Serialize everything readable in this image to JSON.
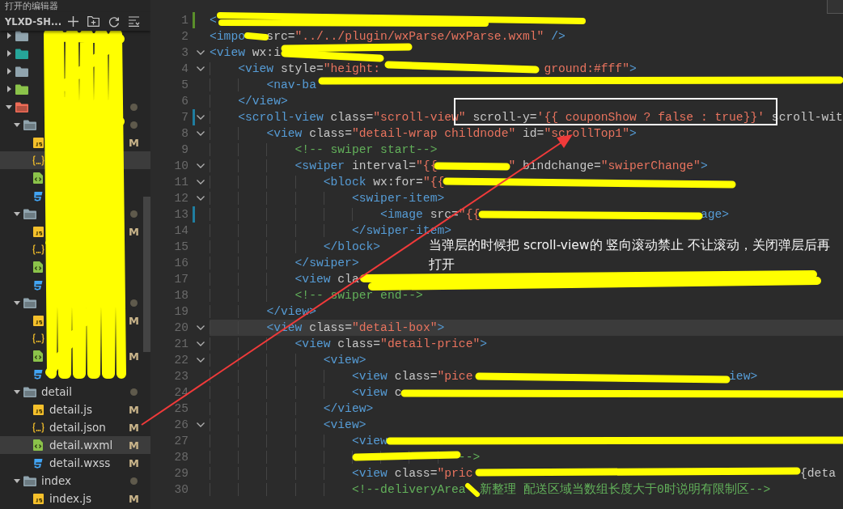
{
  "explorer": {
    "section_title": "打开的编辑器",
    "project": "YLXD-SH...",
    "tree": [
      {
        "kind": "folder",
        "color": "#90a4ae",
        "expanded": false,
        "selected": false
      },
      {
        "kind": "folder",
        "color": "#26a69a",
        "expanded": false,
        "selected": false
      },
      {
        "kind": "folder",
        "color": "#90a4ae",
        "expanded": false,
        "selected": false
      },
      {
        "kind": "folder",
        "color": "#8bc34a",
        "expanded": false,
        "selected": false
      },
      {
        "kind": "folder",
        "color": "#ef6c57",
        "expanded": true,
        "dot": true,
        "selected": false,
        "children": [
          {
            "kind": "folder",
            "color": "#90a4ae",
            "expanded": true,
            "dot": true,
            "selected": false,
            "children": [
              {
                "kind": "js",
                "badge": "M",
                "selected": false
              },
              {
                "kind": "json",
                "selected": true
              },
              {
                "kind": "wxml",
                "selected": false
              },
              {
                "kind": "wxss",
                "selected": false
              }
            ]
          },
          {
            "kind": "folder",
            "color": "#90a4ae",
            "expanded": true,
            "dot": true,
            "selected": false,
            "children": [
              {
                "kind": "js",
                "badge": "M",
                "selected": false
              },
              {
                "kind": "json",
                "selected": false
              },
              {
                "kind": "wxml",
                "selected": false
              },
              {
                "kind": "wxss",
                "selected": false
              }
            ]
          },
          {
            "kind": "folder",
            "color": "#90a4ae",
            "expanded": true,
            "dot": true,
            "selected": false,
            "children": [
              {
                "kind": "js",
                "badge": "M",
                "selected": false
              },
              {
                "kind": "json",
                "selected": false
              },
              {
                "kind": "wxml",
                "badge": "M",
                "selected": false
              },
              {
                "kind": "wxss",
                "selected": false
              }
            ]
          },
          {
            "kind": "folder",
            "name": "detail",
            "color": "#90a4ae",
            "expanded": true,
            "dot": true,
            "selected": false,
            "children": [
              {
                "kind": "js",
                "name": "detail.js",
                "badge": "M",
                "selected": false
              },
              {
                "kind": "json",
                "name": "detail.json",
                "badge": "M",
                "selected": false
              },
              {
                "kind": "wxml",
                "name": "detail.wxml",
                "badge": "M",
                "selected": true
              },
              {
                "kind": "wxss",
                "name": "detail.wxss",
                "badge": "M",
                "selected": false
              }
            ]
          },
          {
            "kind": "folder",
            "name": "index",
            "color": "#90a4ae",
            "expanded": true,
            "dot": true,
            "selected": false,
            "children": [
              {
                "kind": "js",
                "name": "index.js",
                "badge": "M",
                "selected": false
              }
            ]
          }
        ]
      }
    ]
  },
  "editor": {
    "lines": [
      {
        "number": "1",
        "added": true,
        "tokens": [
          {
            "kind": "tag",
            "text": "<"
          }
        ]
      },
      {
        "number": "2",
        "tokens": [
          {
            "kind": "tag",
            "text": "<impo"
          },
          {
            "kind": "attr",
            "text": "   src="
          },
          {
            "kind": "str",
            "text": "\"../../plugin/wxParse/wxParse.wxml\""
          },
          {
            "kind": "tag",
            "text": " />"
          }
        ]
      },
      {
        "number": "3",
        "fold": true,
        "tokens": [
          {
            "kind": "tag",
            "text": "<view"
          },
          {
            "kind": "attr",
            "text": " wx:i"
          }
        ]
      },
      {
        "number": "4",
        "fold": true,
        "tokens": [
          {
            "kind": "tag",
            "text": "    <view"
          },
          {
            "kind": "attr",
            "text": " style="
          },
          {
            "kind": "str",
            "text": "\"height:"
          },
          {
            "kind": "str",
            "text": "                       ground:#fff\""
          },
          {
            "kind": "tag",
            "text": ">"
          }
        ]
      },
      {
        "number": "5",
        "tokens": [
          {
            "kind": "tag",
            "text": "        <nav-ba"
          }
        ]
      },
      {
        "number": "6",
        "tokens": [
          {
            "kind": "tag",
            "text": "    </view>"
          }
        ]
      },
      {
        "number": "7",
        "modified": true,
        "fold": true,
        "tokens": [
          {
            "kind": "tag",
            "text": "    <scroll-view"
          },
          {
            "kind": "attr",
            "text": " class="
          },
          {
            "kind": "str",
            "text": "\"scroll-view\""
          },
          {
            "kind": "attr",
            "text": " scroll-y="
          },
          {
            "kind": "str",
            "text": "'{{ couponShow ? false : true}}'"
          },
          {
            "kind": "attr",
            "text": " scroll-wit"
          }
        ]
      },
      {
        "number": "8",
        "fold": true,
        "tokens": [
          {
            "kind": "tag",
            "text": "        <view"
          },
          {
            "kind": "attr",
            "text": " class="
          },
          {
            "kind": "str",
            "text": "\"detail-wrap childnode\""
          },
          {
            "kind": "attr",
            "text": " id="
          },
          {
            "kind": "str",
            "text": "\"scrollTop1\""
          },
          {
            "kind": "tag",
            "text": ">"
          }
        ]
      },
      {
        "number": "9",
        "tokens": [
          {
            "kind": "comment",
            "text": "            <!-- swiper start-->"
          }
        ]
      },
      {
        "number": "10",
        "fold": true,
        "tokens": [
          {
            "kind": "tag",
            "text": "            <swiper"
          },
          {
            "kind": "attr",
            "text": " interval="
          },
          {
            "kind": "str",
            "text": "\"{{"
          },
          {
            "kind": "str",
            "text": "          \""
          },
          {
            "kind": "attr",
            "text": " bindchange="
          },
          {
            "kind": "str",
            "text": "\"swiperChange\""
          },
          {
            "kind": "tag",
            "text": ">"
          }
        ]
      },
      {
        "number": "11",
        "fold": true,
        "tokens": [
          {
            "kind": "tag",
            "text": "                <block"
          },
          {
            "kind": "attr",
            "text": " wx:for="
          },
          {
            "kind": "str",
            "text": "\"{{"
          }
        ]
      },
      {
        "number": "12",
        "fold": true,
        "tokens": [
          {
            "kind": "tag",
            "text": "                    <swiper-item>"
          }
        ]
      },
      {
        "number": "13",
        "modified": true,
        "tokens": [
          {
            "kind": "tag",
            "text": "                        <image"
          },
          {
            "kind": "attr",
            "text": " src="
          },
          {
            "kind": "str",
            "text": "\"{{"
          },
          {
            "kind": "tag",
            "text": "                               age>"
          }
        ]
      },
      {
        "number": "14",
        "tokens": [
          {
            "kind": "tag",
            "text": "                    </swiper-item>"
          }
        ]
      },
      {
        "number": "15",
        "tokens": [
          {
            "kind": "tag",
            "text": "                </block>"
          }
        ]
      },
      {
        "number": "16",
        "tokens": [
          {
            "kind": "tag",
            "text": "            </swiper>"
          }
        ]
      },
      {
        "number": "17",
        "tokens": [
          {
            "kind": "tag",
            "text": "            <view"
          },
          {
            "kind": "attr",
            "text": " cla"
          }
        ]
      },
      {
        "number": "18",
        "tokens": [
          {
            "kind": "comment",
            "text": "            <!-- swiper end-->"
          }
        ]
      },
      {
        "number": "19",
        "tokens": [
          {
            "kind": "tag",
            "text": "        </view>"
          }
        ]
      },
      {
        "number": "20",
        "fold": true,
        "current": true,
        "tokens": [
          {
            "kind": "tag",
            "text": "        <view"
          },
          {
            "kind": "attr",
            "text": " class="
          },
          {
            "kind": "str",
            "text": "\"detail-box\""
          },
          {
            "kind": "tag",
            "text": ">"
          }
        ]
      },
      {
        "number": "21",
        "fold": true,
        "tokens": [
          {
            "kind": "tag",
            "text": "            <view"
          },
          {
            "kind": "attr",
            "text": " class="
          },
          {
            "kind": "str",
            "text": "\"detail-price\""
          },
          {
            "kind": "tag",
            "text": ">"
          }
        ]
      },
      {
        "number": "22",
        "fold": true,
        "tokens": [
          {
            "kind": "tag",
            "text": "                <view>"
          }
        ]
      },
      {
        "number": "23",
        "tokens": [
          {
            "kind": "tag",
            "text": "                    <view"
          },
          {
            "kind": "attr",
            "text": " class="
          },
          {
            "kind": "str",
            "text": "\"pice"
          },
          {
            "kind": "tag",
            "text": "                                    iew>"
          }
        ]
      },
      {
        "number": "24",
        "tokens": [
          {
            "kind": "tag",
            "text": "                    <view"
          },
          {
            "kind": "attr",
            "text": " c"
          }
        ]
      },
      {
        "number": "25",
        "tokens": [
          {
            "kind": "tag",
            "text": "                </view>"
          }
        ]
      },
      {
        "number": "26",
        "fold": true,
        "tokens": [
          {
            "kind": "tag",
            "text": "                <view>"
          }
        ]
      },
      {
        "number": "27",
        "tokens": [
          {
            "kind": "tag",
            "text": "                    <view"
          }
        ]
      },
      {
        "number": "28",
        "tokens": [
          {
            "kind": "comment",
            "text": "                                   -->"
          }
        ]
      },
      {
        "number": "29",
        "tokens": [
          {
            "kind": "tag",
            "text": "                    <view"
          },
          {
            "kind": "attr",
            "text": " class="
          },
          {
            "kind": "str",
            "text": "\"pric"
          },
          {
            "kind": "attr",
            "text": "                                              {deta"
          }
        ]
      },
      {
        "number": "30",
        "tokens": [
          {
            "kind": "comment",
            "text": "                    <!--deliveryArea"
          },
          {
            "kind": "comment",
            "text": "  新整理 配送区域当数组长度大于0时说明有限制区-->"
          }
        ]
      }
    ]
  },
  "annotation": {
    "note": "当弹层的时候把 scroll-view的 竖向滚动禁止 不让滚动，关闭弹层后再打开"
  }
}
